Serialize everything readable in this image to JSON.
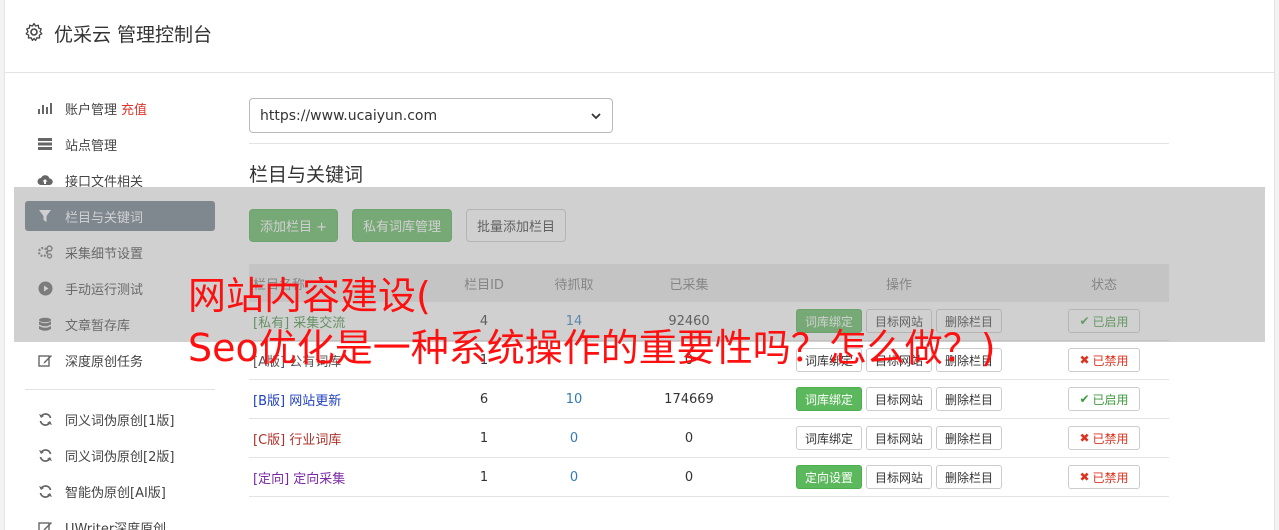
{
  "header": {
    "title": "优采云 管理控制台",
    "icon": "gear-icon"
  },
  "sidebar": {
    "items": [
      {
        "label": "账户管理",
        "extra": "充值",
        "icon": "bar-chart-icon"
      },
      {
        "label": "站点管理",
        "icon": "server-icon"
      },
      {
        "label": "接口文件相关",
        "icon": "cloud-upload-icon"
      },
      {
        "label": "栏目与关键词",
        "icon": "filter-icon",
        "active": true
      },
      {
        "label": "采集细节设置",
        "icon": "cogs-icon"
      },
      {
        "label": "手动运行测试",
        "icon": "play-circle-icon"
      },
      {
        "label": "文章暂存库",
        "icon": "database-icon"
      },
      {
        "label": "深度原创任务",
        "icon": "edit-icon"
      }
    ],
    "items2": [
      {
        "label": "同义词伪原创[1版]",
        "icon": "refresh-icon"
      },
      {
        "label": "同义词伪原创[2版]",
        "icon": "refresh-icon"
      },
      {
        "label": "智能伪原创[AI版]",
        "icon": "refresh-icon"
      },
      {
        "label": "UWriter深度原创",
        "icon": "edit-icon"
      }
    ]
  },
  "site_select": {
    "value": "https://www.ucaiyun.com"
  },
  "section": {
    "title": "栏目与关键词"
  },
  "buttons": {
    "add_column": "添加栏目 +",
    "private_lib": "私有词库管理",
    "batch_add": "批量添加栏目"
  },
  "table": {
    "headers": {
      "name": "栏目名称",
      "id": "栏目ID",
      "wait": "待抓取",
      "done": "已采集",
      "ops": "操作",
      "status": "状态"
    },
    "rows": [
      {
        "tag": "[私有]",
        "name": "采集交流",
        "id": "4",
        "wait": "14",
        "done": "92460",
        "op1": "词库绑定",
        "op2": "目标网站",
        "op3": "删除栏目",
        "status": "已启用",
        "color": "#3c8c3c"
      },
      {
        "tag": "[A版]",
        "name": "公有词库",
        "id": "1",
        "wait": "",
        "done": "0",
        "op1": "词库绑定",
        "op2": "目标网站",
        "op3": "删除栏目",
        "status": "已禁用",
        "color": "#555555"
      },
      {
        "tag": "[B版]",
        "name": "网站更新",
        "id": "6",
        "wait": "10",
        "done": "174669",
        "op1": "词库绑定",
        "op2": "目标网站",
        "op3": "删除栏目",
        "status": "已启用",
        "color": "#1f3fbf"
      },
      {
        "tag": "[C版]",
        "name": "行业词库",
        "id": "1",
        "wait": "0",
        "done": "0",
        "op1": "词库绑定",
        "op2": "目标网站",
        "op3": "删除栏目",
        "status": "已禁用",
        "color": "#b0302a"
      },
      {
        "tag": "[定向]",
        "name": "定向采集",
        "id": "1",
        "wait": "0",
        "done": "0",
        "op1": "定向设置",
        "op2": "目标网站",
        "op3": "删除栏目",
        "status": "已禁用",
        "color": "#7a2aa8"
      }
    ]
  },
  "banner": {
    "line1": "网站内容建设(",
    "line2": "Seo优化是一种系统操作的重要性吗？怎么做？)"
  },
  "colors": {
    "accent_green": "#5cb85c",
    "active_sidebar": "#6c7a89",
    "recharge_red": "#e0352b",
    "banner_red": "#ff1010"
  }
}
